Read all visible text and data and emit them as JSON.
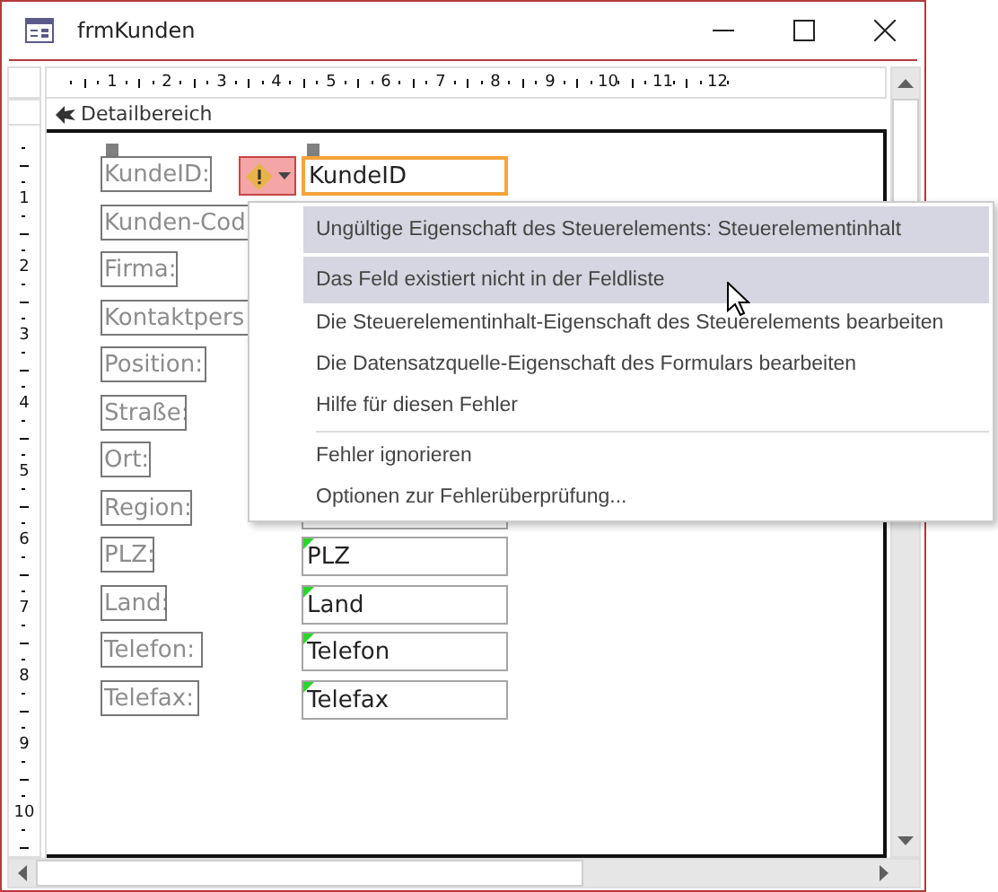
{
  "window": {
    "title": "frmKunden"
  },
  "ruler_h": [
    "1",
    "2",
    "3",
    "4",
    "5",
    "6",
    "7",
    "8",
    "9",
    "10",
    "11",
    "12"
  ],
  "ruler_v": [
    "1",
    "2",
    "3",
    "4",
    "5",
    "6",
    "7",
    "8",
    "9",
    "10"
  ],
  "section": {
    "title": "Detailbereich"
  },
  "controls": [
    {
      "label": "KundeID:",
      "error_indicator": true,
      "textbox": {
        "value": "KundeID",
        "selected": true,
        "flagged": false
      }
    },
    {
      "label": "Kunden-Cod"
    },
    {
      "label": "Firma:"
    },
    {
      "label": "Kontaktpers"
    },
    {
      "label": "Position:"
    },
    {
      "label": "Straße:"
    },
    {
      "label": "Ort:"
    },
    {
      "label": "Region:",
      "textbox": {
        "selected": false
      }
    },
    {
      "label": "PLZ:",
      "textbox": {
        "value": "PLZ",
        "selected": false,
        "flagged": true
      }
    },
    {
      "label": "Land:",
      "textbox": {
        "value": "Land",
        "selected": false,
        "flagged": true
      }
    },
    {
      "label": "Telefon:",
      "textbox": {
        "value": "Telefon",
        "selected": false,
        "flagged": true
      }
    },
    {
      "label": "Telefax:",
      "textbox": {
        "value": "Telefax",
        "selected": false,
        "flagged": true
      }
    }
  ],
  "error_menu": [
    {
      "kind": "header",
      "text": "Ungültige Eigenschaft des Steuerelements: Steuerelementinhalt"
    },
    {
      "kind": "item",
      "text": "Das Feld existiert nicht in der Feldliste",
      "highlighted": true
    },
    {
      "kind": "item",
      "text": "Die Steuerelementinhalt-Eigenschaft des Steuerelements bearbeiten",
      "highlighted": false
    },
    {
      "kind": "item",
      "text": "Die Datensatzquelle-Eigenschaft des Formulars bearbeiten",
      "highlighted": false
    },
    {
      "kind": "item",
      "text": "Hilfe für diesen Fehler",
      "highlighted": false
    },
    {
      "kind": "separator"
    },
    {
      "kind": "item",
      "text": "Fehler ignorieren",
      "highlighted": false
    },
    {
      "kind": "item",
      "text": "Optionen zur Fehlerüberprüfung...",
      "highlighted": false
    }
  ]
}
